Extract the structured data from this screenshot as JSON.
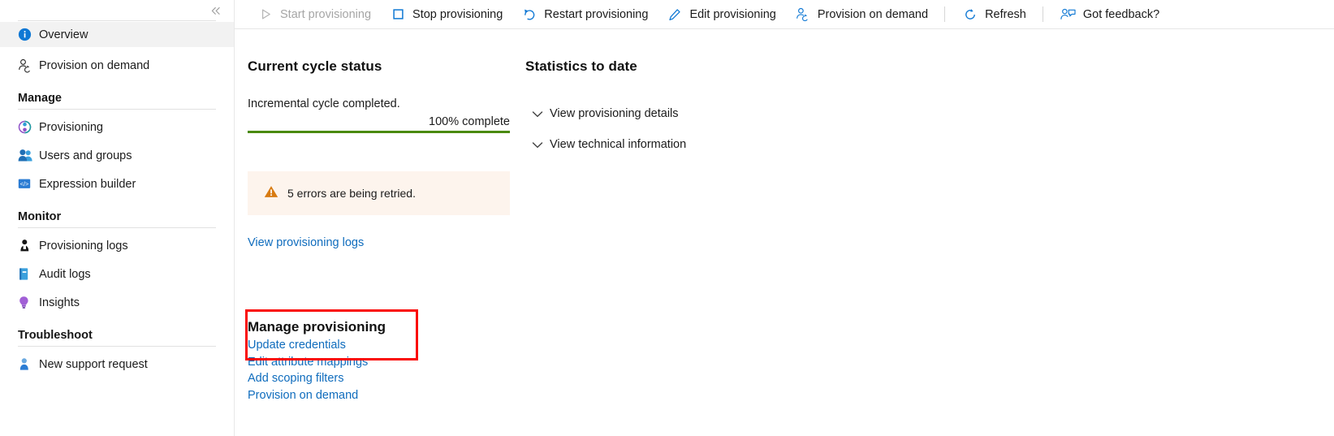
{
  "sidebar": {
    "collapse_icon": "chevron-double-left-icon",
    "items": [
      {
        "label": "Overview",
        "icon": "info-circle-icon",
        "selected": true
      },
      {
        "label": "Provision on demand",
        "icon": "person-sync-icon",
        "selected": false
      }
    ],
    "groups": [
      {
        "title": "Manage",
        "items": [
          {
            "label": "Provisioning",
            "icon": "provisioning-icon"
          },
          {
            "label": "Users and groups",
            "icon": "users-group-icon"
          },
          {
            "label": "Expression builder",
            "icon": "code-brackets-icon"
          }
        ]
      },
      {
        "title": "Monitor",
        "items": [
          {
            "label": "Provisioning logs",
            "icon": "person-logs-icon"
          },
          {
            "label": "Audit logs",
            "icon": "book-icon"
          },
          {
            "label": "Insights",
            "icon": "lightbulb-icon"
          }
        ]
      },
      {
        "title": "Troubleshoot",
        "items": [
          {
            "label": "New support request",
            "icon": "support-person-icon"
          }
        ]
      }
    ]
  },
  "toolbar": {
    "buttons": [
      {
        "label": "Start provisioning",
        "icon": "play-triangle-icon",
        "disabled": true,
        "separator_after": false
      },
      {
        "label": "Stop provisioning",
        "icon": "stop-square-icon",
        "disabled": false,
        "separator_after": false
      },
      {
        "label": "Restart provisioning",
        "icon": "restart-arrow-icon",
        "disabled": false,
        "separator_after": false
      },
      {
        "label": "Edit provisioning",
        "icon": "pencil-icon",
        "disabled": false,
        "separator_after": false
      },
      {
        "label": "Provision on demand",
        "icon": "person-sync-icon",
        "disabled": false,
        "separator_after": true
      },
      {
        "label": "Refresh",
        "icon": "refresh-circle-icon",
        "disabled": false,
        "separator_after": true
      },
      {
        "label": "Got feedback?",
        "icon": "feedback-person-icon",
        "disabled": false,
        "separator_after": false
      }
    ]
  },
  "main": {
    "cycle": {
      "title": "Current cycle status",
      "status_text": "Incremental cycle completed.",
      "progress_label": "100% complete",
      "progress_percent": 100,
      "progress_color": "#4a8a0f"
    },
    "warning": {
      "icon": "warning-triangle-icon",
      "text": "5 errors are being retried.",
      "background": "#fdf4ed",
      "icon_color": "#d87b12"
    },
    "view_logs_link": "View provisioning logs",
    "manage": {
      "title": "Manage provisioning",
      "links": [
        "Update credentials",
        "Edit attribute mappings",
        "Add scoping filters",
        "Provision on demand"
      ]
    },
    "statistics": {
      "title": "Statistics to date",
      "expanders": [
        {
          "label": "View provisioning details",
          "icon": "chevron-down-icon"
        },
        {
          "label": "View technical information",
          "icon": "chevron-down-icon"
        }
      ]
    },
    "annotation": {
      "color": "#fa0a08"
    }
  }
}
